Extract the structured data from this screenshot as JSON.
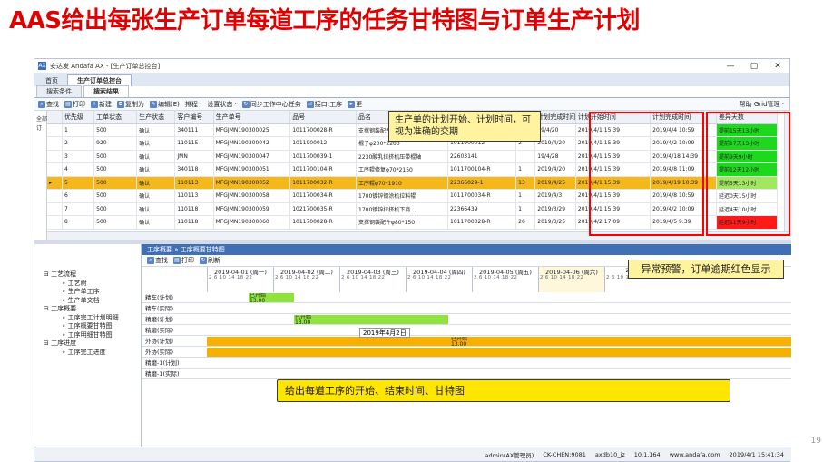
{
  "slide": {
    "title": "AAS给出每张生产订单每道工序的任务甘特图与订单生产计划",
    "page_number": "19"
  },
  "window": {
    "title": "安达发 Andafa AX - [生产订单总控台]",
    "controls": [
      "—",
      "▢",
      "✕"
    ]
  },
  "menubar": {
    "tabs": [
      {
        "label": "首页",
        "active": false
      },
      {
        "label": "生产订单总控台",
        "active": true
      }
    ]
  },
  "subtabs": [
    {
      "label": "搜索条件",
      "active": false
    },
    {
      "label": "搜索结果",
      "active": true
    }
  ],
  "toolbar": {
    "items": [
      {
        "icon": "search-icon",
        "label": "查找"
      },
      {
        "icon": "print-icon",
        "label": "打印"
      },
      {
        "icon": "new-icon",
        "label": "新建"
      },
      {
        "icon": "copy-icon",
        "label": "复制为"
      },
      {
        "icon": "edit-icon",
        "label": "编辑(E)"
      },
      {
        "icon": "sort-icon",
        "label": "排程 ·"
      },
      {
        "icon": "status-icon",
        "label": "设置状态 ·"
      },
      {
        "icon": "sync-icon",
        "label": "同步工作中心任务"
      },
      {
        "icon": "interface-icon",
        "label": "接口:工序"
      },
      {
        "icon": "more-icon",
        "label": "更"
      }
    ],
    "right": "帮助  Grid管理 ·"
  },
  "upper_tree": {
    "items": [
      "全部",
      "订"
    ]
  },
  "orders_table": {
    "columns": [
      "",
      "优先级",
      "工单状态",
      "生产状态",
      "客户编号",
      "生产单号",
      "品号",
      "品名",
      "",
      "",
      "",
      "",
      "计划开始时间",
      "计划完成时间",
      "差异天数"
    ],
    "hidden_col_label": "计划完成时间",
    "rows": [
      {
        "idx": "1",
        "priority": "500",
        "status": "确认",
        "pstatus": "",
        "cust": "340111",
        "order": "MFGJMN190300025",
        "item": "1011700028-R",
        "name": "支撑钢装配件",
        "c9": "",
        "c10": "",
        "c11": "",
        "done_date": "19/4/20",
        "plan_start": "2019/4/1 15:39",
        "plan_end": "2019/4/4 10:59",
        "diff": "提前15天13小时",
        "diff_color": "green"
      },
      {
        "idx": "2",
        "priority": "920",
        "status": "确认",
        "pstatus": "",
        "cust": "110115",
        "order": "MFGJMN190300042",
        "item": "1011900012",
        "name": "棍子φ200*2200",
        "c9": "",
        "c10": "1011900012",
        "c11": "2",
        "done_date": "2019/4/20",
        "plan_start": "2019/4/1 15:39",
        "plan_end": "2019/4/2 10:09",
        "diff": "提前17天13小时",
        "diff_color": "green"
      },
      {
        "idx": "3",
        "priority": "500",
        "status": "确认",
        "pstatus": "",
        "cust": "JMN",
        "order": "MFGJMN190300047",
        "item": "1011700039-1",
        "name": "2230酸乳拉挤机压带棍轴",
        "c9": "",
        "c10": "22603141",
        "c11": "",
        "done_date": "19/4/28",
        "plan_start": "2019/4/1 15:39",
        "plan_end": "2019/4/18 14:39",
        "diff": "提前9天9小时",
        "diff_color": "green"
      },
      {
        "idx": "4",
        "priority": "500",
        "status": "确认",
        "pstatus": "",
        "cust": "340118",
        "order": "MFGJMN190300051",
        "item": "1011700104-R",
        "name": "工序辊修复φ70*2150",
        "c9": "",
        "c10": "1011700104-R",
        "c11": "1",
        "done_date": "2019/4/20",
        "plan_start": "2019/4/1 15:39",
        "plan_end": "2019/4/8 11:09",
        "diff": "提前12天12小时",
        "diff_color": "green"
      },
      {
        "idx": "5",
        "priority": "500",
        "status": "确认",
        "pstatus": "",
        "cust": "110113",
        "order": "MFGJMN190300052",
        "item": "1011700032-R",
        "name": "工序辊φ70*1910",
        "c9": "",
        "c10": "22366029-1",
        "c11": "13",
        "done_date": "2019/4/25",
        "plan_start": "2019/4/1 15:39",
        "plan_end": "2019/4/19 10:39",
        "diff": "提前5天13小时",
        "diff_color": "lgreen",
        "selected": true
      },
      {
        "idx": "6",
        "priority": "500",
        "status": "确认",
        "pstatus": "",
        "cust": "110113",
        "order": "MFGJMN190300058",
        "item": "1011700034-R",
        "name": "1700镀锌钢涂机拉料辊",
        "c9": "",
        "c10": "1011700034-R",
        "c11": "1",
        "done_date": "2019/4/3",
        "plan_start": "2019/4/1 15:39",
        "plan_end": "2019/4/8 10:59",
        "diff": "延迟0天15小时",
        "diff_color": ""
      },
      {
        "idx": "7",
        "priority": "500",
        "status": "确认",
        "pstatus": "",
        "cust": "110118",
        "order": "MFGJMN190300059",
        "item": "1021700035-R",
        "name": "1700镀锌拉挤机下商…",
        "c9": "",
        "c10": "22366439",
        "c11": "1",
        "done_date": "2019/3/29",
        "plan_start": "2019/4/1 15:39",
        "plan_end": "2019/4/2 10:09",
        "diff": "延迟4天10小时",
        "diff_color": ""
      },
      {
        "idx": "8",
        "priority": "500",
        "status": "确认",
        "pstatus": "",
        "cust": "110118",
        "order": "MFGJMN190300060",
        "item": "1011700028-R",
        "name": "支撑钢装配件φ80*150",
        "c9": "",
        "c10": "1011700028-R",
        "c11": "26",
        "done_date": "2019/3/25",
        "plan_start": "2019/4/2 17:09",
        "plan_end": "2019/4/5 9:39",
        "diff": "延迟11天9小时",
        "diff_color": "red"
      }
    ]
  },
  "lower_tree": {
    "items": [
      {
        "label": "工艺流程",
        "level": 0
      },
      {
        "label": "工艺树",
        "level": 1
      },
      {
        "label": "生产单工序",
        "level": 1
      },
      {
        "label": "生产单文档",
        "level": 1
      },
      {
        "label": "工序概要",
        "level": 0
      },
      {
        "label": "工序完工计划明细",
        "level": 1
      },
      {
        "label": "工序概要甘特图",
        "level": 1
      },
      {
        "label": "工序明细甘特图",
        "level": 1
      },
      {
        "label": "工序进度",
        "level": 0
      },
      {
        "label": "工序完工进度",
        "level": 1
      }
    ]
  },
  "gantt": {
    "breadcrumb": "工序概要 » 工序概要甘特图",
    "toolbar": [
      "查找",
      "打印",
      "刷新"
    ],
    "days": [
      {
        "label": "2019-04-01 (周一)"
      },
      {
        "label": "2019-04-02 (周二)"
      },
      {
        "label": "2019-04-03 (周三)"
      },
      {
        "label": "2019-04-04 (周四)"
      },
      {
        "label": "2019-04-05 (周五)"
      },
      {
        "label": "2019-04-06 (周六)"
      },
      {
        "label": "2019-04"
      }
    ],
    "hours": "2 6 10 14 18 22",
    "rows": [
      "精车(计划)",
      "精车(实际)",
      "精磨(计划)",
      "精磨(实际)",
      "外协(计划)",
      "外协(实际)",
      "精磨-1(计划)",
      "精磨-1(实际)"
    ],
    "bars": [
      {
        "row": 0,
        "label1": "已开始",
        "label2": "13.00",
        "color": "#8ee43a"
      },
      {
        "row": 2,
        "label1": "已开始",
        "label2": "13.00",
        "color": "#8ee43a"
      },
      {
        "row": 4,
        "label1": "已开始",
        "label2": "13.00",
        "color": "#f5b000"
      },
      {
        "row": 5,
        "label1": "",
        "label2": "",
        "color": "#f5b000"
      }
    ],
    "date_tooltip": "2019年4月2日"
  },
  "statusbar": {
    "items": [
      "admin(AX管理员)",
      "CK-CHEN:9081",
      "axdb10_jz",
      "10.1.164",
      "www.andafa.com",
      "2019/4/1 15:41:34"
    ]
  },
  "callouts": {
    "top": "生产单的计划开始、计划时间，可视为准确的交期",
    "right": "异常预警，订单逾期红色显示",
    "bottom": "给出每道工序的开始、结束时间、甘特图"
  }
}
